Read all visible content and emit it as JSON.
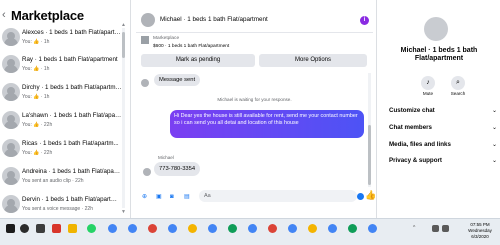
{
  "sidebar": {
    "back_icon": "back-arrow-icon",
    "title": "Marketplace",
    "conversations": [
      {
        "name": "Alexces · 1 beds 1 bath Flat/apartment",
        "sub": "You: 👍 · 1h"
      },
      {
        "name": "Ray · 1 beds 1 bath Flat/apartment",
        "sub": "You: 👍 · 1h"
      },
      {
        "name": "Dirchy · 1 beds 1 bath Flat/apartment",
        "sub": "You: 👍 · 1h"
      },
      {
        "name": "La'shawn · 1 beds 1 bath Flat/apartm...",
        "sub": "You: 👍 · 22h"
      },
      {
        "name": "Ricas · 1 beds 1 bath Flat/apartm...",
        "sub": "You: 👍 · 22h"
      },
      {
        "name": "Andreina · 1 beds 1 bath Flat/apartm...",
        "sub": "You sent an audio clip · 22h"
      },
      {
        "name": "Dervin · 1 beds 1 bath Flat/apartment",
        "sub": "You sent a voice message · 22h"
      }
    ]
  },
  "chat": {
    "title": "Michael · 1 beds 1 bath Flat/apartment",
    "info_icon": "info-icon",
    "marketplace_label": "Marketplace",
    "listing": "$600 · 1 beds 1 bath Flat/apartment",
    "mark_pending": "Mark as pending",
    "more_options": "More Options",
    "messages": {
      "msg_sent": "Message sent",
      "waiting": "Michael is waiting for your response.",
      "outgoing": "Hi Dear yes the house is still available for rent, send me your contact number so i can send you all detai and location of this house",
      "sender": "Michael",
      "incoming": "773-780-3354"
    },
    "composer_placeholder": "Aa"
  },
  "right_panel": {
    "name": "Michael · 1 beds 1 bath Flat/apartment",
    "mute": "Mute",
    "search": "Search",
    "rows": [
      "Customize chat",
      "Chat members",
      "Media, files and links",
      "Privacy & support"
    ]
  },
  "taskbar": {
    "time": "07:55 PM",
    "day": "Wednesday",
    "date": "6/3/2020"
  }
}
